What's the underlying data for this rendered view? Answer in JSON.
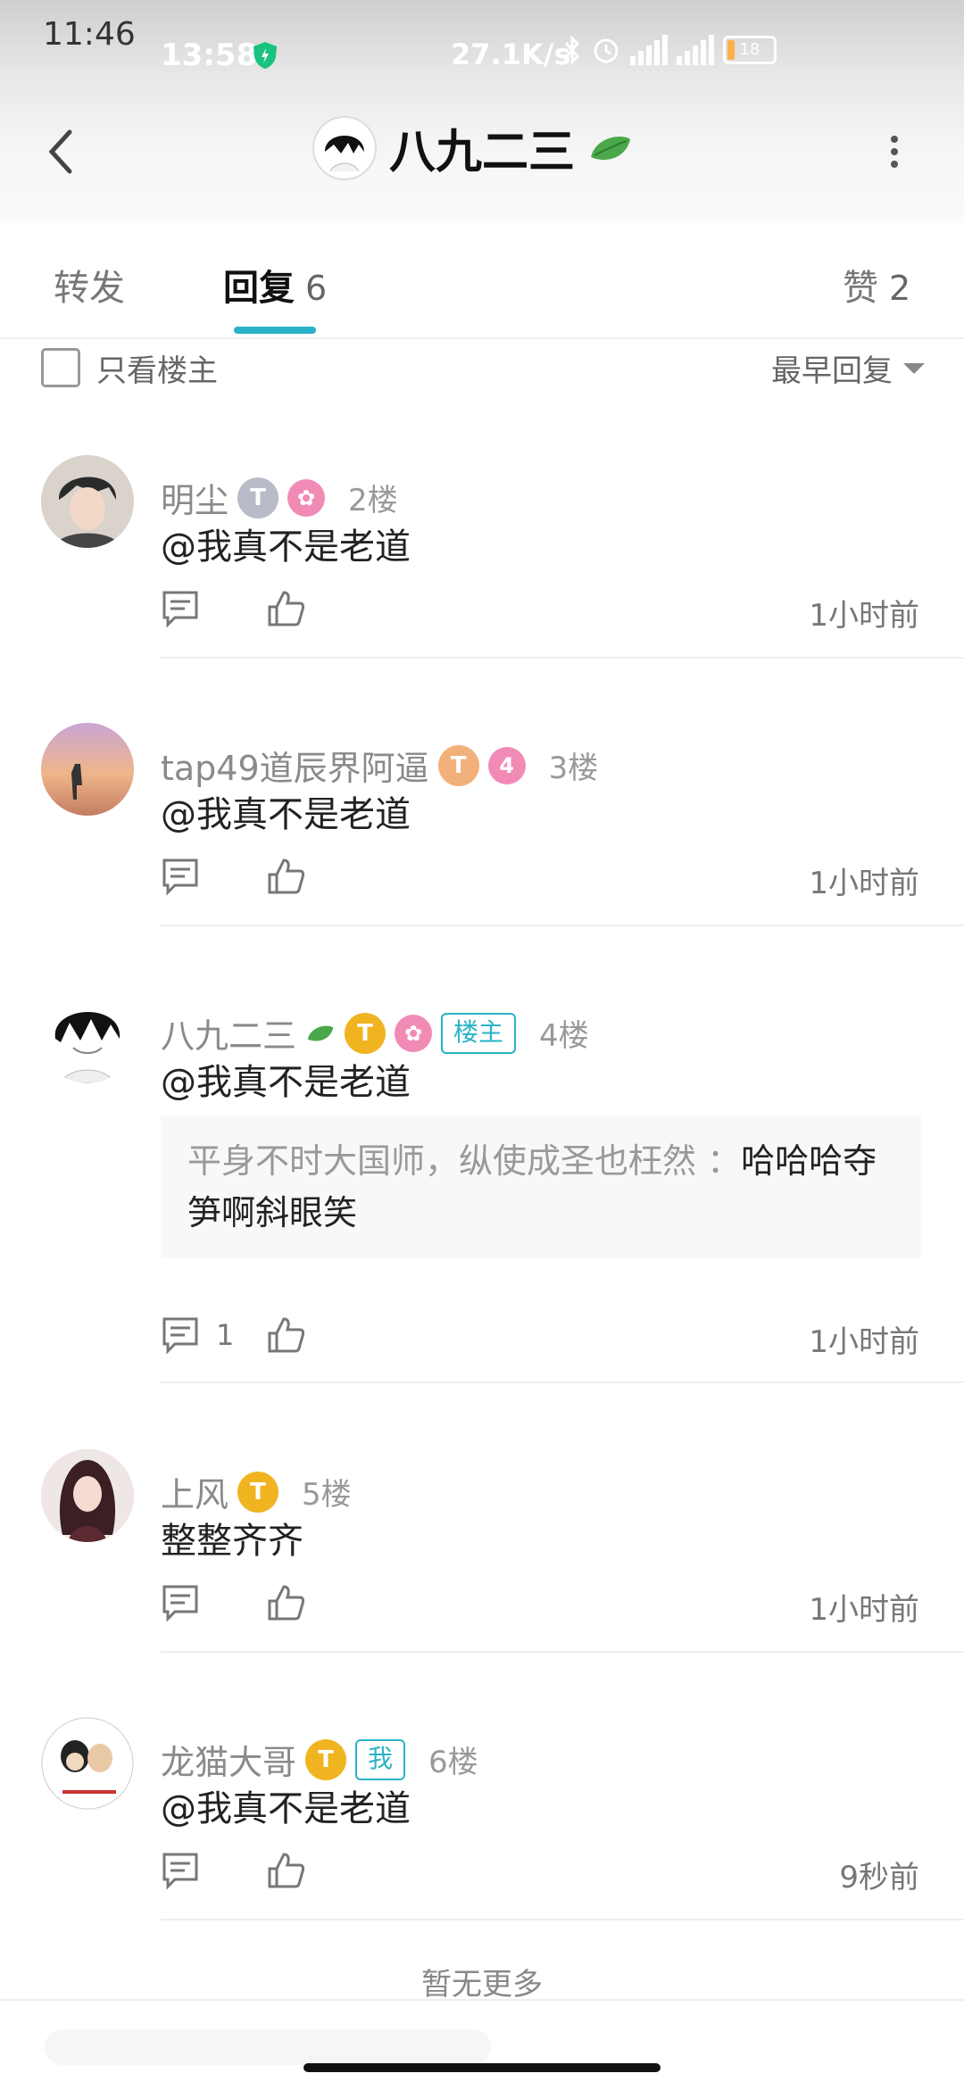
{
  "status_bar": {
    "outer_time": "11:46",
    "time": "13:58",
    "speed": "27.1K/s",
    "battery": "18"
  },
  "header": {
    "title": "八九二三",
    "back_icon": "chevron-left-icon",
    "more_icon": "more-vertical-icon"
  },
  "tabs": [
    {
      "label": "转发",
      "count": ""
    },
    {
      "label": "回复",
      "count": "6"
    },
    {
      "label": "赞",
      "count": "2"
    }
  ],
  "filter": {
    "only_op_label": "只看楼主",
    "sort_label": "最早回复"
  },
  "replies": [
    {
      "name": "明尘",
      "floor": "2楼",
      "content": "@我真不是老道",
      "time": "1小时前",
      "comments": ""
    },
    {
      "name": "tap49道辰界阿逼",
      "floor": "3楼",
      "content": "@我真不是老道",
      "time": "1小时前",
      "comments": "",
      "badge_text": "4"
    },
    {
      "name": "八九二三",
      "floor": "4楼",
      "content": "@我真不是老道",
      "time": "1小时前",
      "comments": "1",
      "tag": "楼主",
      "quote": {
        "prefix": "平身不时大国师，纵使成圣也枉然 ：",
        "text": "哈哈哈夺笋啊斜眼笑"
      }
    },
    {
      "name": "上风",
      "floor": "5楼",
      "content": "整整齐齐",
      "time": "1小时前",
      "comments": ""
    },
    {
      "name": "龙猫大哥",
      "floor": "6楼",
      "content": "@我真不是老道",
      "time": "9秒前",
      "comments": "",
      "tag": "我"
    }
  ],
  "footer": {
    "no_more": "暂无更多"
  },
  "colors": {
    "accent": "#2ab3c6",
    "badge_gold": "#f0b420",
    "badge_silver": "#b8bcc8",
    "badge_bronze": "#f2b07a",
    "badge_pink": "#f18bb5"
  }
}
